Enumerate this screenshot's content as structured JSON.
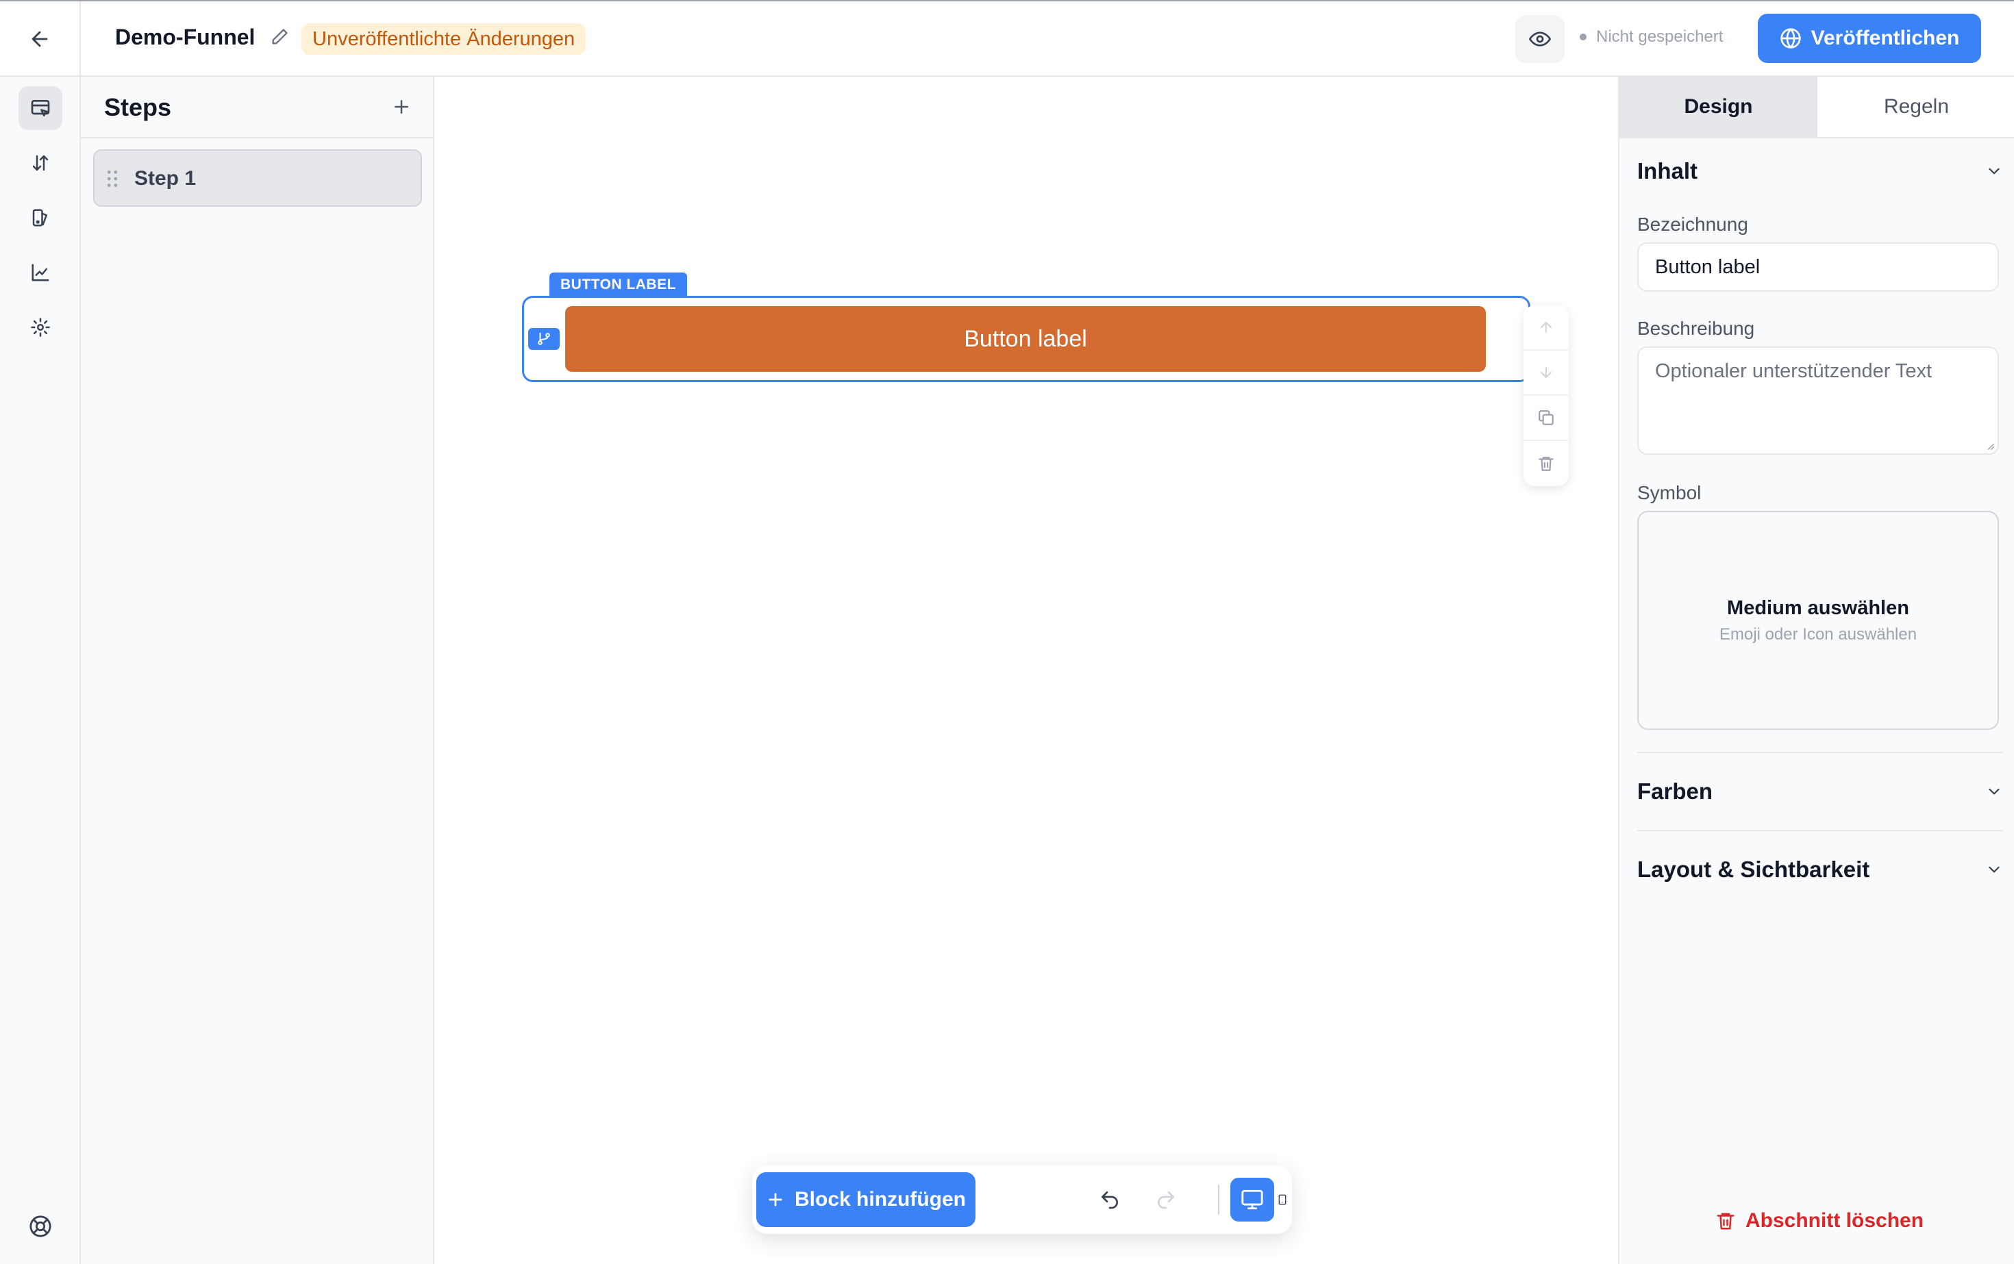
{
  "header": {
    "funnel_title": "Demo-Funnel",
    "unpublished_badge": "Unveröffentlichte Änderungen",
    "save_status": "Nicht gespeichert",
    "publish_label": "Veröffentlichen"
  },
  "sidebar": {
    "icons": [
      "editor-icon",
      "sort-icon",
      "theme-icon",
      "analytics-icon",
      "settings-icon"
    ],
    "active_index": 0,
    "bottom_icon": "help-icon"
  },
  "steps": {
    "title": "Steps",
    "items": [
      {
        "label": "Step 1"
      }
    ]
  },
  "canvas": {
    "block_tag": "BUTTON LABEL",
    "button_label": "Button label",
    "button_color": "#d46b30",
    "accent_color": "#3b82f6"
  },
  "toolbar": {
    "add_block_label": "Block hinzufügen",
    "active_device": "desktop"
  },
  "properties": {
    "tabs": [
      {
        "label": "Design"
      },
      {
        "label": "Regeln"
      }
    ],
    "active_tab": 0,
    "content_section": "Inhalt",
    "label_field": {
      "label": "Bezeichnung",
      "value": "Button label"
    },
    "description_field": {
      "label": "Beschreibung",
      "placeholder": "Optionaler unterstützender Text"
    },
    "symbol_field": {
      "label": "Symbol",
      "title": "Medium auswählen",
      "subtitle": "Emoji oder Icon auswählen"
    },
    "colors_section": "Farben",
    "layout_section": "Layout & Sichtbarkeit",
    "delete_label": "Abschnitt löschen"
  }
}
